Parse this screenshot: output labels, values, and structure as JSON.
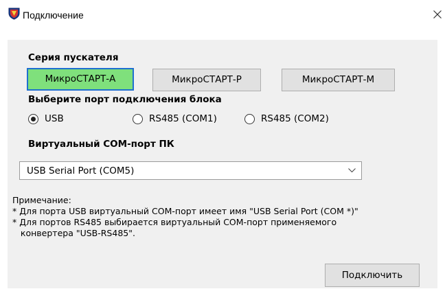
{
  "window": {
    "title": "Подключение",
    "icons": {
      "app": "shield-app-icon",
      "close": "close-icon"
    }
  },
  "series": {
    "label": "Серия пускателя",
    "buttons": [
      "МикроСТАРТ-А",
      "МикроСТАРТ-Р",
      "МикроСТАРТ-М"
    ],
    "selected": "МикроСТАРТ-А"
  },
  "port": {
    "label": "Выберите порт подключения блока",
    "options": [
      "USB",
      "RS485 (COM1)",
      "RS485 (COM2)"
    ],
    "selected": "USB"
  },
  "virtual_com": {
    "label": "Виртуальный COM-порт ПК",
    "value": "USB Serial Port (COM5)"
  },
  "note": {
    "title": "Примечание:",
    "lines": [
      "* Для порта USB виртуальный COM-порт имеет имя \"USB Serial Port (COM *)\"",
      "* Для портов RS485 выбирается виртуальный COM-порт применяемого",
      "   конвертера \"USB-RS485\"."
    ]
  },
  "actions": {
    "connect_label": "Подключить"
  },
  "colors": {
    "active_button": "#7fe07c",
    "focus_border": "#1e6fd0",
    "panel_bg": "#f0f0f0"
  }
}
